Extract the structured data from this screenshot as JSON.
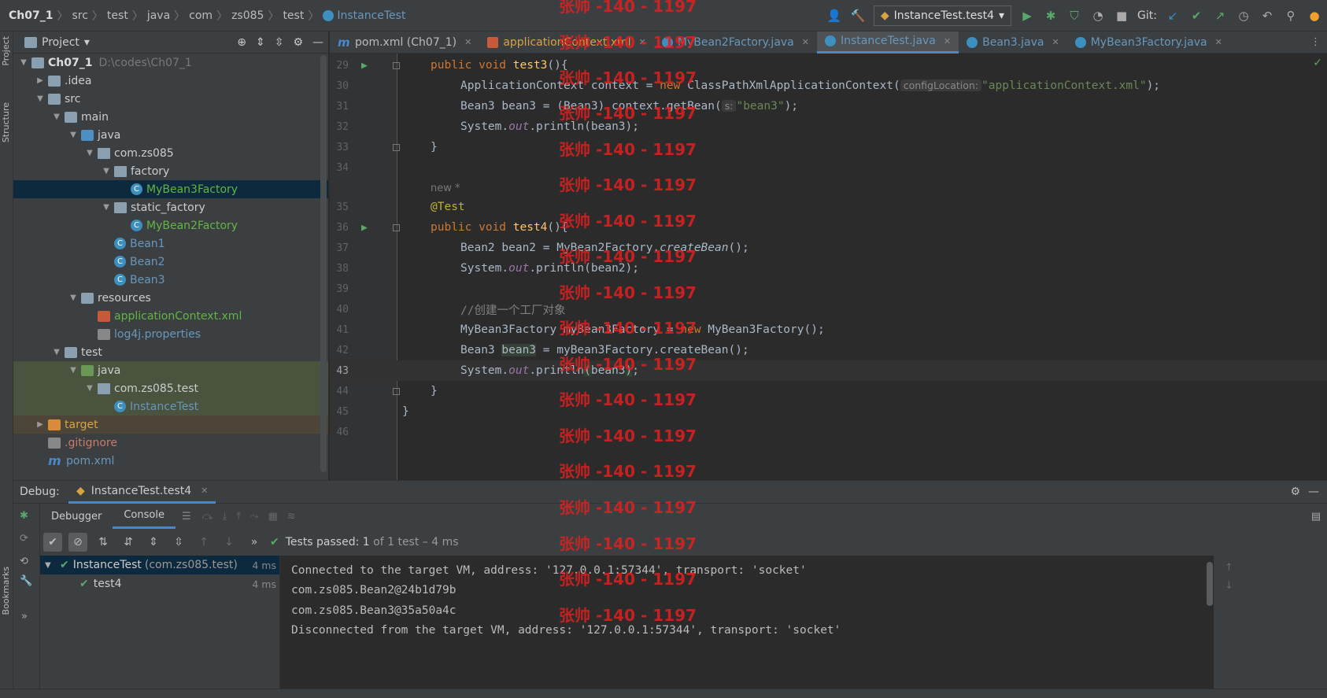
{
  "breadcrumb": [
    "Ch07_1",
    "src",
    "test",
    "java",
    "com",
    "zs085",
    "test"
  ],
  "breadcrumb_class": "InstanceTest",
  "run_config": "InstanceTest.test4",
  "git_label": "Git:",
  "left_strip": {
    "project": "Project",
    "structure": "Structure",
    "bookmarks": "Bookmarks"
  },
  "project_panel": {
    "title": "Project",
    "tree": [
      {
        "label": "Ch07_1",
        "extra": "D:\\codes\\Ch07_1"
      },
      {
        "label": ".idea"
      },
      {
        "label": "src"
      },
      {
        "label": "main"
      },
      {
        "label": "java"
      },
      {
        "label": "com.zs085"
      },
      {
        "label": "factory"
      },
      {
        "label": "MyBean3Factory"
      },
      {
        "label": "static_factory"
      },
      {
        "label": "MyBean2Factory"
      },
      {
        "label": "Bean1"
      },
      {
        "label": "Bean2"
      },
      {
        "label": "Bean3"
      },
      {
        "label": "resources"
      },
      {
        "label": "applicationContext.xml"
      },
      {
        "label": "log4j.properties"
      },
      {
        "label": "test"
      },
      {
        "label": "java"
      },
      {
        "label": "com.zs085.test"
      },
      {
        "label": "InstanceTest"
      },
      {
        "label": "target"
      },
      {
        "label": ".gitignore"
      },
      {
        "label": "pom.xml"
      }
    ]
  },
  "tabs": [
    {
      "label": "pom.xml (Ch07_1)"
    },
    {
      "label": "applicationContext.xml"
    },
    {
      "label": "MyBean2Factory.java"
    },
    {
      "label": "InstanceTest.java"
    },
    {
      "label": "Bean3.java"
    },
    {
      "label": "MyBean3Factory.java"
    }
  ],
  "editor": {
    "line_numbers": [
      "29",
      "30",
      "31",
      "32",
      "33",
      "34",
      "35",
      "36",
      "37",
      "38",
      "39",
      "40",
      "41",
      "42",
      "43",
      "44",
      "45",
      "46"
    ],
    "usage_hint": "new *",
    "code": {
      "l29_kw": "public void ",
      "l29_fn": "test3",
      "l29_rest": "(){",
      "l30_a": "ApplicationContext context = ",
      "l30_kw": "new ",
      "l30_b": "ClassPathXmlApplicationContext(",
      "l30_hint": "configLocation:",
      "l30_str": "\"applicationContext.xml\"",
      "l30_end": ");",
      "l31_a": "Bean3 bean3 = (Bean3) context.getBean(",
      "l31_hint": "s:",
      "l31_str": "\"bean3\"",
      "l31_end": ");",
      "l32_a": "System.",
      "l32_out": "out",
      "l32_b": ".println(bean3);",
      "l33": "}",
      "l35": "@Test",
      "l36_kw": "public void ",
      "l36_fn": "test4",
      "l36_rest": "(){",
      "l37_a": "Bean2 bean2 = MyBean2Factory.",
      "l37_it": "createBean",
      "l37_b": "();",
      "l38_a": "System.",
      "l38_out": "out",
      "l38_b": ".println(bean2);",
      "l40": "//创建一个工厂对象",
      "l41_a": "MyBean3Factory myBean3Factory = ",
      "l41_kw": "new ",
      "l41_b": "MyBean3Factory();",
      "l42_a": "Bean3 ",
      "l42_hl": "bean3",
      "l42_b": " = myBean3Factory.createBean();",
      "l43_a": "System.",
      "l43_out": "out",
      "l43_b": ".println",
      "l43_p1": "(",
      "l43_c": "bean3",
      "l43_p2": ")",
      "l43_end": ";",
      "l44": "}",
      "l45": "}"
    }
  },
  "watermark": "张帅 -140 - 1197",
  "debug": {
    "title": "Debug:",
    "tab": "InstanceTest.test4",
    "subtabs": [
      "Debugger",
      "Console"
    ],
    "tests_passed_label": "Tests passed:",
    "tests_passed_count": "1",
    "tests_passed_rest": "of 1 test – 4 ms",
    "results": [
      {
        "name": "InstanceTest",
        "extra": "(com.zs085.test)",
        "time": "4 ms"
      },
      {
        "name": "test4",
        "time": "4 ms"
      }
    ],
    "console": [
      "Connected to the target VM, address: '127.0.0.1:57344', transport: 'socket'",
      "com.zs085.Bean2@24b1d79b",
      "com.zs085.Bean3@35a50a4c",
      "Disconnected from the target VM, address: '127.0.0.1:57344', transport: 'socket'"
    ]
  },
  "colors": {
    "keyword": "#cc7832",
    "function": "#ffc66d",
    "string": "#6a8759",
    "annotation": "#bbb529",
    "accent": "#4a88c7",
    "pass": "#59a869",
    "watermark": "#e02020"
  }
}
